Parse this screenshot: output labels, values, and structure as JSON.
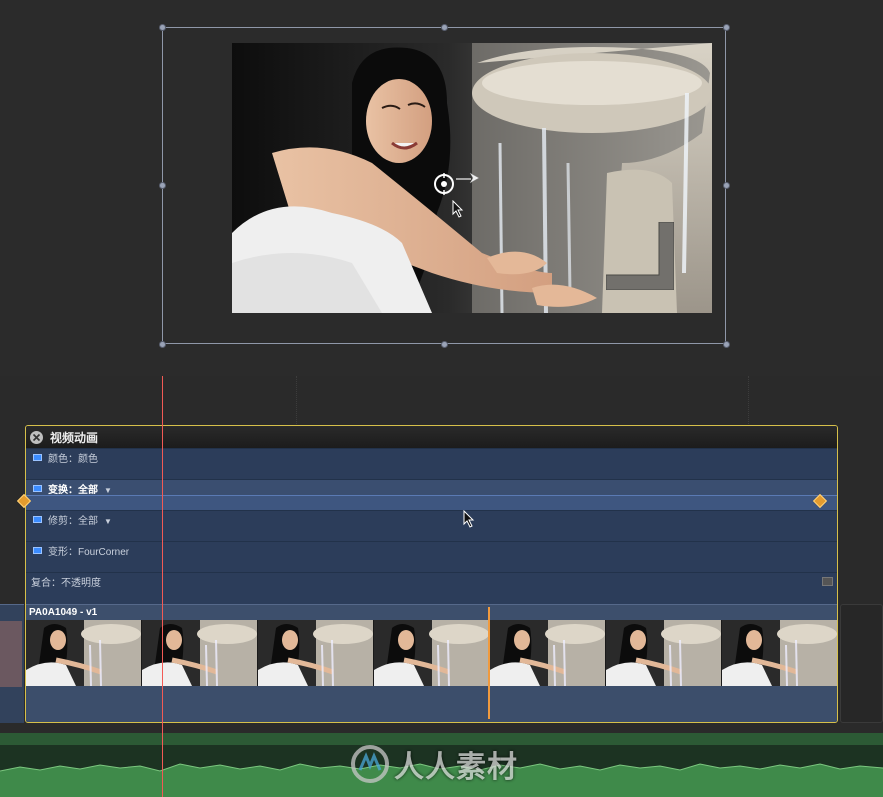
{
  "animation_editor": {
    "title": "视频动画",
    "lanes": [
      {
        "label": "颜色：颜色"
      },
      {
        "label": "变换：全部",
        "dropdown": true,
        "selected": true
      },
      {
        "label": "修剪：全部",
        "dropdown": true
      },
      {
        "label": "变形：FourCorner"
      }
    ],
    "composite_label": "复合：不透明度"
  },
  "clip": {
    "name": "PA0A1049 - v1"
  },
  "watermark": {
    "text": "人人素材"
  },
  "colors": {
    "accent_selection": "#d6c04a",
    "playhead": "#f25a55",
    "skimmer": "#f09a3e",
    "keyframe": "#e39b2e",
    "audio_waveform": "#3f8a4a"
  },
  "icons": [
    "close-icon",
    "dropdown-caret-icon",
    "keyframe-icon",
    "transform-center-icon",
    "rotation-handle-icon",
    "pointer-cursor-icon"
  ]
}
